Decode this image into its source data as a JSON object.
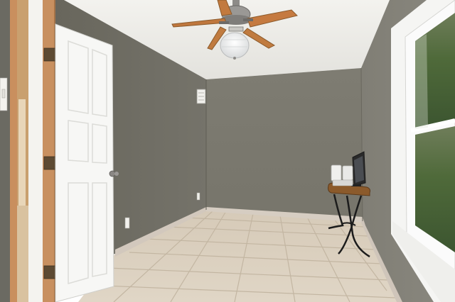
{
  "scene": {
    "subject": "empty-room-interior",
    "colors": {
      "wall_back": "#7c7a70",
      "wall_left": "#6f6d62",
      "wall_right": "#84827a",
      "ceiling": "#eeede9",
      "floor": "#d9cebd",
      "grout": "#c4b7a3",
      "baseboard": "#d2c8bd",
      "door": "#f6f6f4",
      "door_frame": "#c98f5e",
      "window_frame": "#fbfbfb",
      "fan_blade": "#c57a40",
      "fan_metal": "#8d8b88",
      "table_top": "#8b5a2b",
      "table_legs": "#1c1c1c"
    },
    "objects": [
      {
        "id": "ceiling-fan",
        "icon": "fan-icon"
      },
      {
        "id": "light-globe",
        "icon": "lamp-icon"
      },
      {
        "id": "hvac-vent",
        "icon": "vent-icon"
      },
      {
        "id": "open-door",
        "icon": "door-icon"
      },
      {
        "id": "window",
        "icon": "window-icon"
      },
      {
        "id": "side-table",
        "icon": "table-icon"
      },
      {
        "id": "monitor",
        "icon": "monitor-icon"
      },
      {
        "id": "speaker",
        "icon": "speaker-icon"
      },
      {
        "id": "electrical-outlet",
        "icon": "outlet-icon"
      },
      {
        "id": "light-switch",
        "icon": "switch-icon"
      }
    ]
  }
}
